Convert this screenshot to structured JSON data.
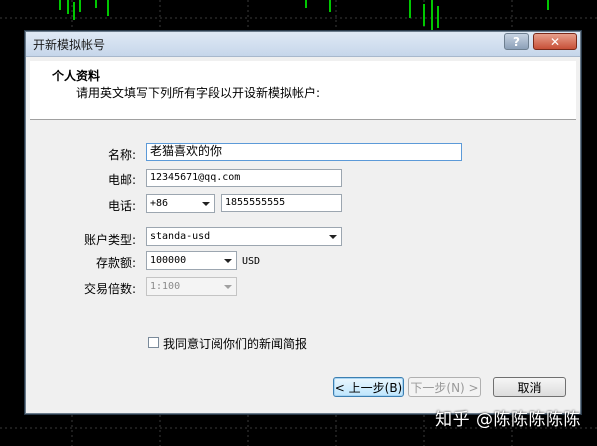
{
  "dialog": {
    "title": "开新模拟帐号",
    "help_glyph": "?",
    "close_glyph": "✕"
  },
  "header": {
    "title": "个人资料",
    "subtitle": "请用英文填写下列所有字段以开设新模拟帐户:"
  },
  "form": {
    "name_label": "名称:",
    "name_value": "老猫喜欢的你",
    "email_label": "电邮:",
    "email_value": "12345671@qq.com",
    "phone_label": "电话:",
    "phone_code": "+86",
    "phone_value": "1855555555",
    "account_type_label": "账户类型:",
    "account_type_value": "standa-usd",
    "deposit_label": "存款额:",
    "deposit_value": "100000",
    "deposit_currency": "USD",
    "leverage_label": "交易倍数:",
    "leverage_value": "1:100",
    "agree_label": "我同意订阅你们的新闻简报",
    "agree_checked": false
  },
  "buttons": {
    "back": "< 上一步(B)",
    "next": "下一步(N) >",
    "cancel": "取消"
  },
  "watermark": "知乎 @陈陈陈陈陈"
}
